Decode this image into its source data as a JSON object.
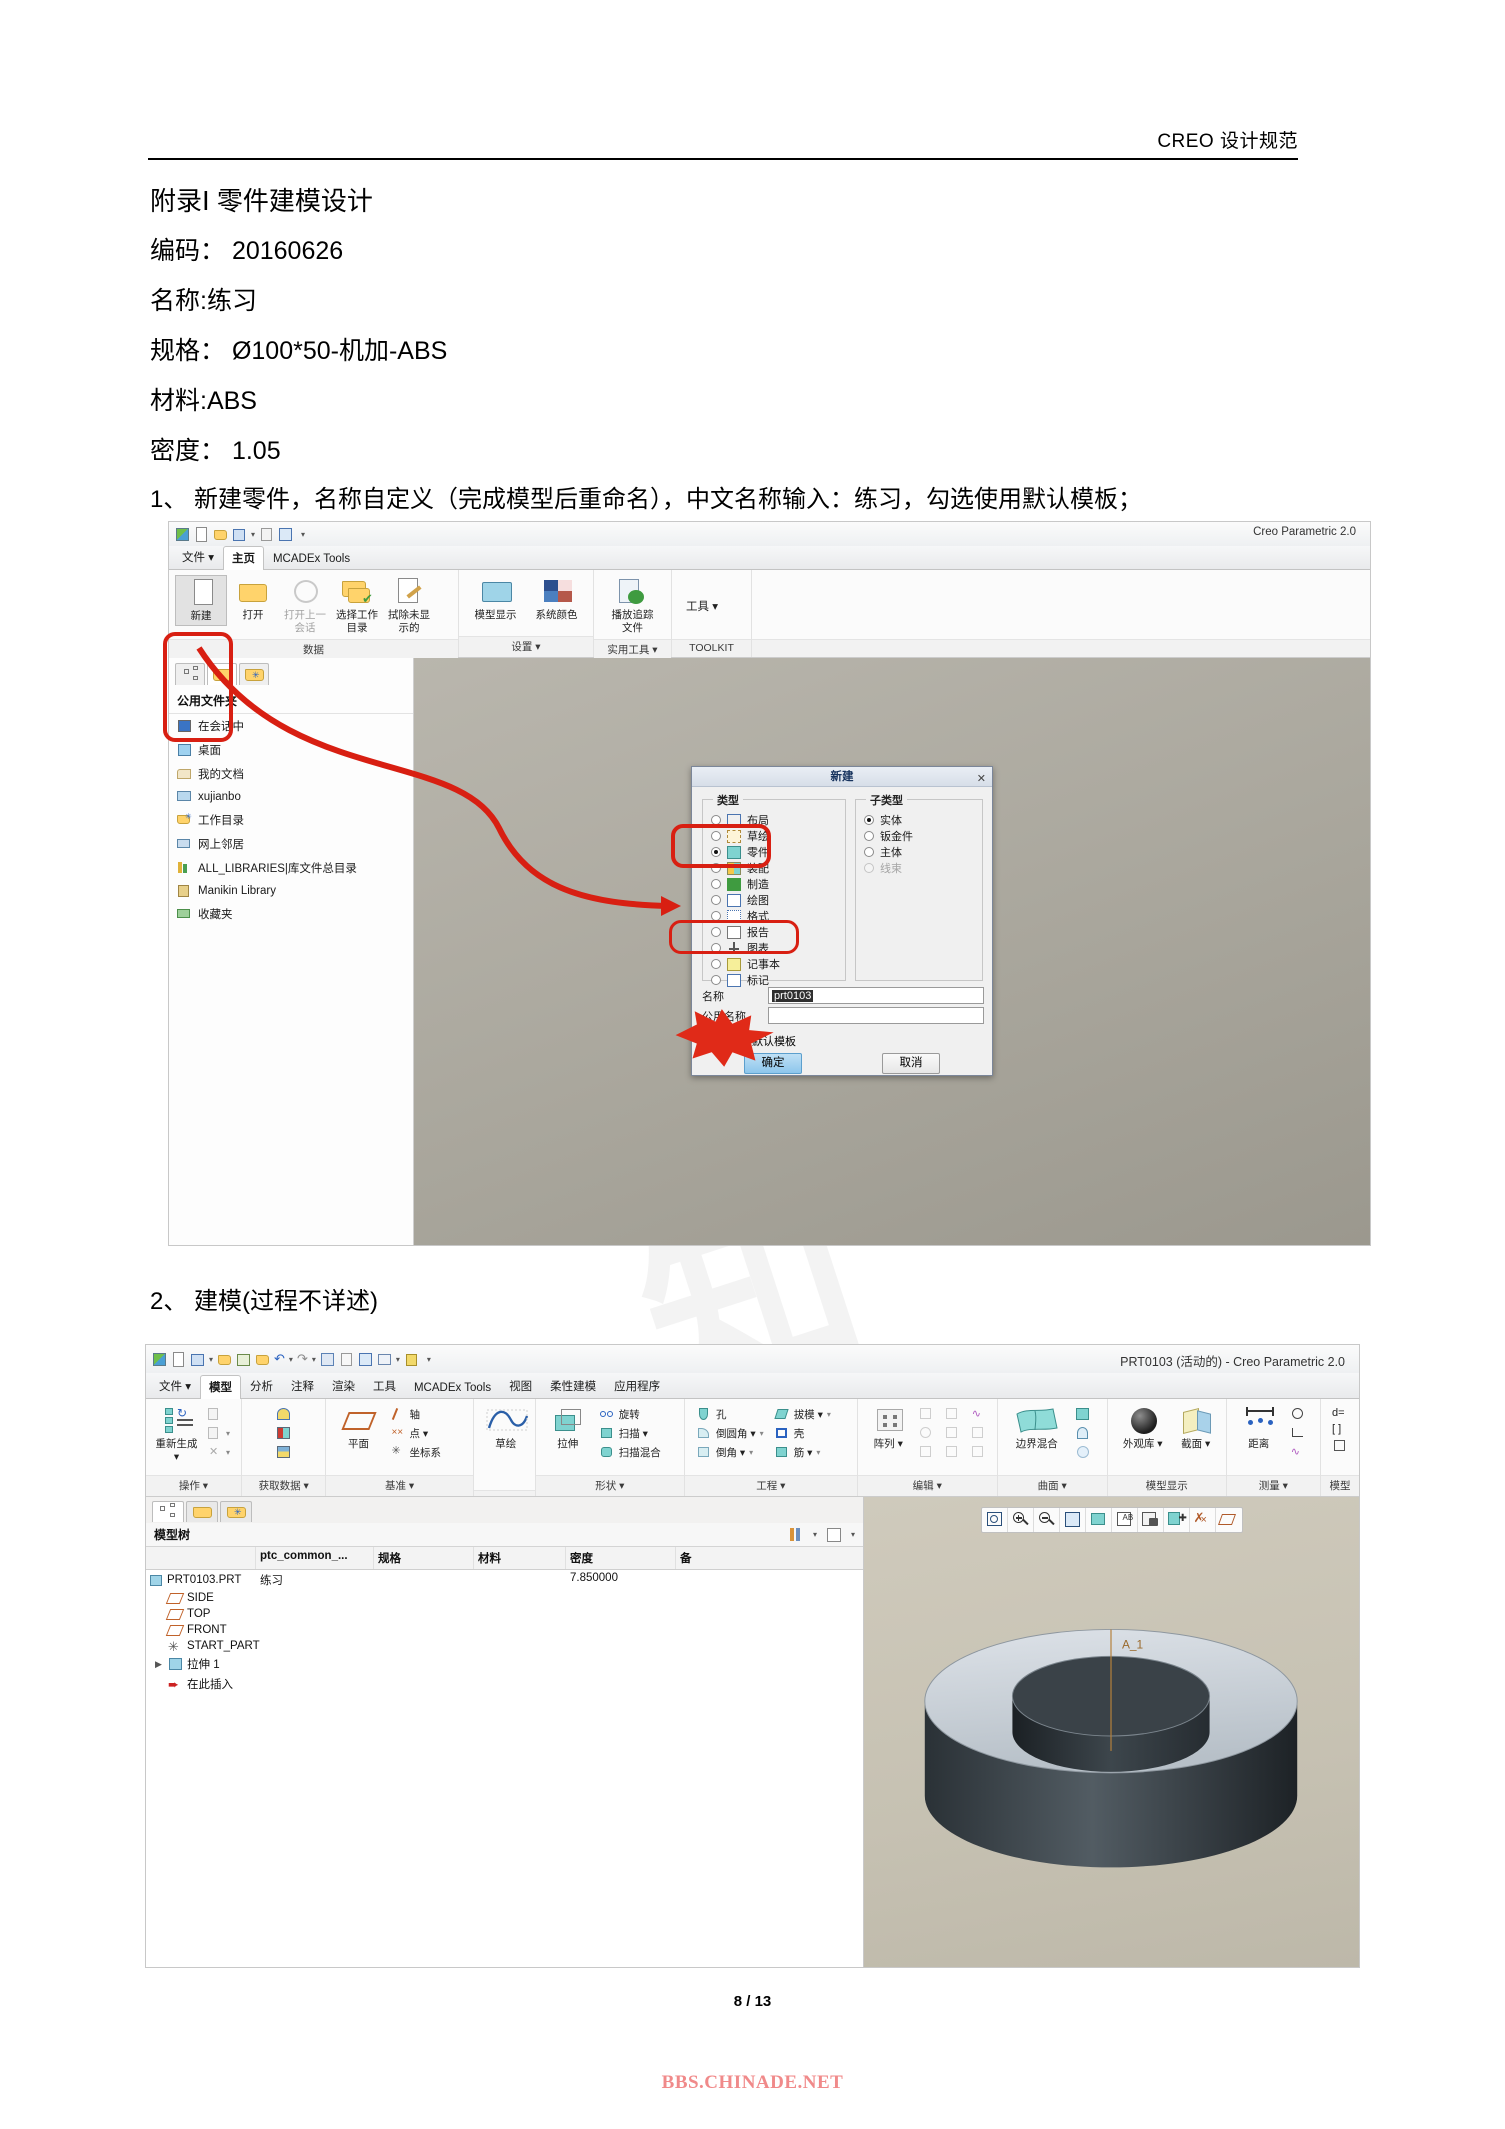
{
  "header": {
    "running_title": "CREO 设计规范"
  },
  "doc": {
    "lines": [
      "附录Ⅰ  零件建模设计",
      "编码： 20160626",
      "名称:练习",
      "规格： Ø100*50-机加-ABS",
      "材料:ABS",
      "密度： 1.05"
    ],
    "step1": "1、 新建零件，名称自定义（完成模型后重命名），中文名称输入：练习，勾选使用默认模板；",
    "step2": "2、 建模(过程不详述)"
  },
  "shot1": {
    "caption": "Creo Parametric 2.0",
    "tabs": [
      {
        "label": "文件 ▾",
        "active": false
      },
      {
        "label": "主页",
        "active": true
      },
      {
        "label": "MCADEx Tools",
        "active": false
      }
    ],
    "ribbon": [
      {
        "label": "数据",
        "buttons": [
          {
            "label": "新建",
            "icon": "new-file-icon"
          },
          {
            "label": "打开",
            "icon": "open-folder-icon"
          },
          {
            "label": "打开上一\n会话",
            "icon": "previous-session-icon"
          },
          {
            "label": "选择工作\n目录",
            "icon": "set-working-directory-icon"
          },
          {
            "label": "拭除未显\n示的",
            "icon": "erase-not-displayed-icon"
          }
        ]
      },
      {
        "label": "设置 ▾",
        "buttons": [
          {
            "label": "模型显示",
            "icon": "model-display-icon"
          },
          {
            "label": "系统颜色",
            "icon": "system-colors-icon"
          }
        ]
      },
      {
        "label": "实用工具 ▾",
        "buttons": [
          {
            "label": "播放追踪\n文件",
            "icon": "play-trail-file-icon"
          }
        ]
      },
      {
        "label": "TOOLKIT",
        "buttons": [
          {
            "label": "工具 ▾",
            "icon": "tools-icon"
          }
        ]
      }
    ],
    "navigator": {
      "title": "公用文件夹",
      "items": [
        {
          "label": "在会话中",
          "icon": "in-session-icon"
        },
        {
          "label": "桌面",
          "icon": "desktop-icon"
        },
        {
          "label": "我的文档",
          "icon": "my-documents-icon"
        },
        {
          "label": "xujianbo",
          "icon": "computer-icon"
        },
        {
          "label": "工作目录",
          "icon": "working-directory-icon"
        },
        {
          "label": "网上邻居",
          "icon": "network-neighborhood-icon"
        },
        {
          "label": "ALL_LIBRARIES|库文件总目录",
          "icon": "library-icon"
        },
        {
          "label": "Manikin Library",
          "icon": "manikin-library-icon"
        },
        {
          "label": "收藏夹",
          "icon": "favorites-icon"
        }
      ]
    },
    "dialog": {
      "title": "新建",
      "close": "✕",
      "type_legend": "类型",
      "subtype_legend": "子类型",
      "types": [
        {
          "label": "布局",
          "selected": false,
          "icon": "layout-icon"
        },
        {
          "label": "草绘",
          "selected": false,
          "icon": "sketch-icon"
        },
        {
          "label": "零件",
          "selected": true,
          "icon": "part-icon"
        },
        {
          "label": "装配",
          "selected": false,
          "icon": "assembly-icon"
        },
        {
          "label": "制造",
          "selected": false,
          "icon": "manufacturing-icon"
        },
        {
          "label": "绘图",
          "selected": false,
          "icon": "drawing-icon"
        },
        {
          "label": "格式",
          "selected": false,
          "icon": "format-icon"
        },
        {
          "label": "报告",
          "selected": false,
          "icon": "report-icon"
        },
        {
          "label": "图表",
          "selected": false,
          "icon": "diagram-icon"
        },
        {
          "label": "记事本",
          "selected": false,
          "icon": "notebook-icon"
        },
        {
          "label": "标记",
          "selected": false,
          "icon": "markup-icon"
        }
      ],
      "subtypes": [
        {
          "label": "实体",
          "selected": true,
          "disabled": false
        },
        {
          "label": "钣金件",
          "selected": false,
          "disabled": false
        },
        {
          "label": "主体",
          "selected": false,
          "disabled": false
        },
        {
          "label": "线束",
          "selected": false,
          "disabled": true
        }
      ],
      "name_label": "名称",
      "name_value": "prt0103",
      "common_name_label": "公用名称",
      "common_name_value": "",
      "use_default_template": "使用默认模板",
      "ok": "确定",
      "cancel": "取消"
    }
  },
  "shot2": {
    "caption": "PRT0103 (活动的) - Creo Parametric 2.0",
    "tabs": [
      {
        "label": "文件 ▾",
        "active": false
      },
      {
        "label": "模型",
        "active": true
      },
      {
        "label": "分析",
        "active": false
      },
      {
        "label": "注释",
        "active": false
      },
      {
        "label": "渲染",
        "active": false
      },
      {
        "label": "工具",
        "active": false
      },
      {
        "label": "MCADEx Tools",
        "active": false
      },
      {
        "label": "视图",
        "active": false
      },
      {
        "label": "柔性建模",
        "active": false
      },
      {
        "label": "应用程序",
        "active": false
      }
    ],
    "ribbon": [
      {
        "label": "操作 ▾",
        "big": [
          {
            "label": "重新生成 ▾",
            "icon": "regenerate-icon"
          }
        ],
        "small": []
      },
      {
        "label": "获取数据 ▾",
        "big": [],
        "small": [
          {
            "label": "",
            "icon": "import-icon"
          },
          {
            "label": "",
            "icon": "merge-icon"
          },
          {
            "label": "",
            "icon": "shrinkwrap-icon"
          }
        ]
      },
      {
        "label": "基准 ▾",
        "big": [
          {
            "label": "平面",
            "icon": "datum-plane-icon"
          }
        ],
        "small": [
          {
            "label": "轴",
            "icon": "datum-axis-icon"
          },
          {
            "label": "点 ▾",
            "icon": "datum-point-icon"
          },
          {
            "label": "坐标系",
            "icon": "coordinate-system-icon"
          }
        ]
      },
      {
        "label": "",
        "big": [
          {
            "label": "草绘",
            "icon": "sketch-icon"
          }
        ],
        "small": []
      },
      {
        "label": "形状 ▾",
        "big": [
          {
            "label": "拉伸",
            "icon": "extrude-icon"
          }
        ],
        "small": [
          {
            "label": "旋转",
            "icon": "revolve-icon"
          },
          {
            "label": "扫描 ▾",
            "icon": "sweep-icon"
          },
          {
            "label": "扫描混合",
            "icon": "swept-blend-icon"
          }
        ]
      },
      {
        "label": "工程 ▾",
        "big": [],
        "small": [
          {
            "label": "孔",
            "icon": "hole-icon"
          },
          {
            "label": "倒圆角 ▾",
            "icon": "round-icon"
          },
          {
            "label": "倒角 ▾",
            "icon": "chamfer-icon"
          },
          {
            "label": "拔模 ▾",
            "icon": "draft-icon"
          },
          {
            "label": "壳",
            "icon": "shell-icon"
          },
          {
            "label": "筋 ▾",
            "icon": "rib-icon"
          }
        ]
      },
      {
        "label": "编辑 ▾",
        "big": [
          {
            "label": "阵列 ▾",
            "icon": "pattern-icon"
          }
        ],
        "small": []
      },
      {
        "label": "曲面 ▾",
        "big": [
          {
            "label": "边界混合",
            "icon": "boundary-blend-icon"
          }
        ],
        "small": []
      },
      {
        "label": "模型显示",
        "big": [
          {
            "label": "外观库 ▾",
            "icon": "appearance-gallery-icon"
          },
          {
            "label": "截面 ▾",
            "icon": "section-icon"
          }
        ],
        "small": []
      },
      {
        "label": "测量 ▾",
        "big": [
          {
            "label": "距离",
            "icon": "distance-icon"
          }
        ],
        "small": []
      },
      {
        "label": "模型",
        "big": [],
        "small": []
      }
    ],
    "model_tree": {
      "title": "模型树",
      "columns": [
        "",
        "ptc_common_...",
        "规格",
        "材料",
        "密度",
        "备"
      ],
      "root": {
        "name": "PRT0103.PRT",
        "common_name": "练习",
        "spec": "",
        "material": "",
        "density": "7.850000",
        "note": ""
      },
      "children": [
        {
          "label": "SIDE",
          "icon": "datum-plane-icon"
        },
        {
          "label": "TOP",
          "icon": "datum-plane-icon"
        },
        {
          "label": "FRONT",
          "icon": "datum-plane-icon"
        },
        {
          "label": "START_PART",
          "icon": "coordinate-system-icon"
        },
        {
          "label": "拉伸 1",
          "icon": "extrude-feature-icon",
          "expandable": true
        },
        {
          "label": "在此插入",
          "icon": "insert-here-icon"
        }
      ]
    },
    "viewport": {
      "annotation": "A_1",
      "toolbar": [
        {
          "icon": "zoom-refit-icon"
        },
        {
          "icon": "zoom-in-icon"
        },
        {
          "icon": "zoom-out-icon"
        },
        {
          "icon": "repaint-icon"
        },
        {
          "icon": "display-style-icon"
        },
        {
          "icon": "datum-display-icon"
        },
        {
          "icon": "saved-views-icon"
        },
        {
          "icon": "view-manager-icon"
        },
        {
          "icon": "datum-off-icon"
        },
        {
          "icon": "annotation-display-icon"
        }
      ]
    }
  },
  "footer": {
    "page": "8 / 13",
    "watermark": "BBS.CHINADE.NET"
  }
}
